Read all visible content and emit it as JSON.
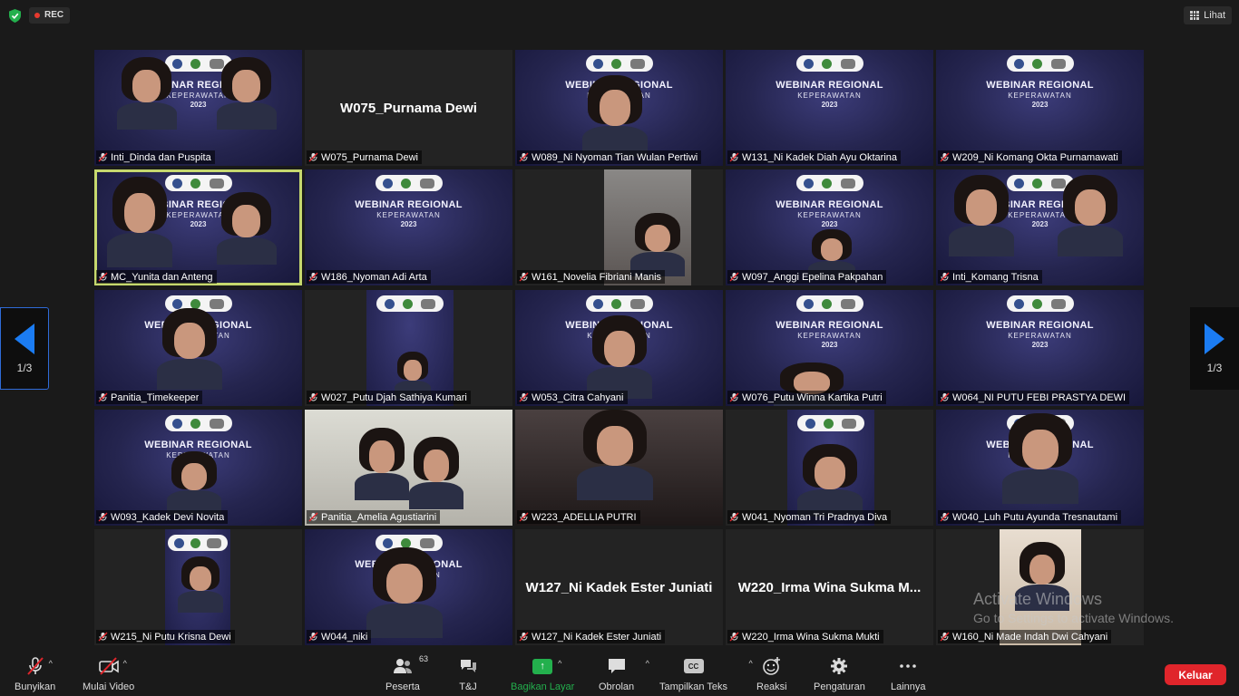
{
  "topbar": {
    "rec_label": "REC",
    "view_label": "Lihat"
  },
  "pager": {
    "left": "1/3",
    "right": "1/3"
  },
  "banner": {
    "title": "WEBINAR REGIONAL",
    "sub": "KEPERAWATAN",
    "year": "2023"
  },
  "tiles": [
    {
      "name": "Inti_Dinda dan Puspita"
    },
    {
      "name": "W075_Purnama Dewi",
      "display": "W075_Purnama Dewi"
    },
    {
      "name": "W089_Ni Nyoman Tian Wulan Pertiwi"
    },
    {
      "name": "W131_Ni Kadek Diah Ayu Oktarina"
    },
    {
      "name": "W209_Ni Komang Okta Purnamawati"
    },
    {
      "name": "MC_Yunita dan Anteng"
    },
    {
      "name": "W186_Nyoman Adi Arta"
    },
    {
      "name": "W161_Novelia Fibriani Manis"
    },
    {
      "name": "W097_Anggi Epelina Pakpahan"
    },
    {
      "name": "Inti_Komang Trisna"
    },
    {
      "name": "Panitia_Timekeeper"
    },
    {
      "name": "W027_Putu Djah Sathiya Kumari"
    },
    {
      "name": "W053_Citra Cahyani"
    },
    {
      "name": "W076_Putu Winna Kartika Putri"
    },
    {
      "name": "W064_NI PUTU FEBI PRASTYA DEWI"
    },
    {
      "name": "W093_Kadek Devi Novita"
    },
    {
      "name": "Panitia_Amelia Agustiarini"
    },
    {
      "name": "W223_ADELLIA PUTRI"
    },
    {
      "name": "W041_Nyoman Tri Pradnya Diva"
    },
    {
      "name": "W040_Luh Putu Ayunda Tresnautami"
    },
    {
      "name": "W215_Ni Putu Krisna Dewi"
    },
    {
      "name": "W044_niki"
    },
    {
      "name": "W127_Ni Kadek Ester Juniati",
      "display": "W127_Ni Kadek Ester Juniati"
    },
    {
      "name": "W220_Irma Wina Sukma Mukti",
      "display": "W220_Irma Wina Sukma M..."
    },
    {
      "name": "W160_Ni Made Indah Dwi Cahyani"
    }
  ],
  "watermark": {
    "title": "Activate Windows",
    "sub": "Go to Settings to activate Windows."
  },
  "toolbar": {
    "unmute": "Bunyikan",
    "start_video": "Mulai Video",
    "participants": "Peserta",
    "participants_count": "63",
    "qa": "T&J",
    "share": "Bagikan Layar",
    "chat": "Obrolan",
    "captions": "Tampilkan Teks",
    "captions_icon": "CC",
    "reactions": "Reaksi",
    "settings": "Pengaturan",
    "more": "Lainnya",
    "leave": "Keluar"
  },
  "colors": {
    "share_green": "#23b04d",
    "leave_red": "#e0252b",
    "active_speaker": "#c6d86e",
    "arrow_blue": "#1b7cf3"
  }
}
